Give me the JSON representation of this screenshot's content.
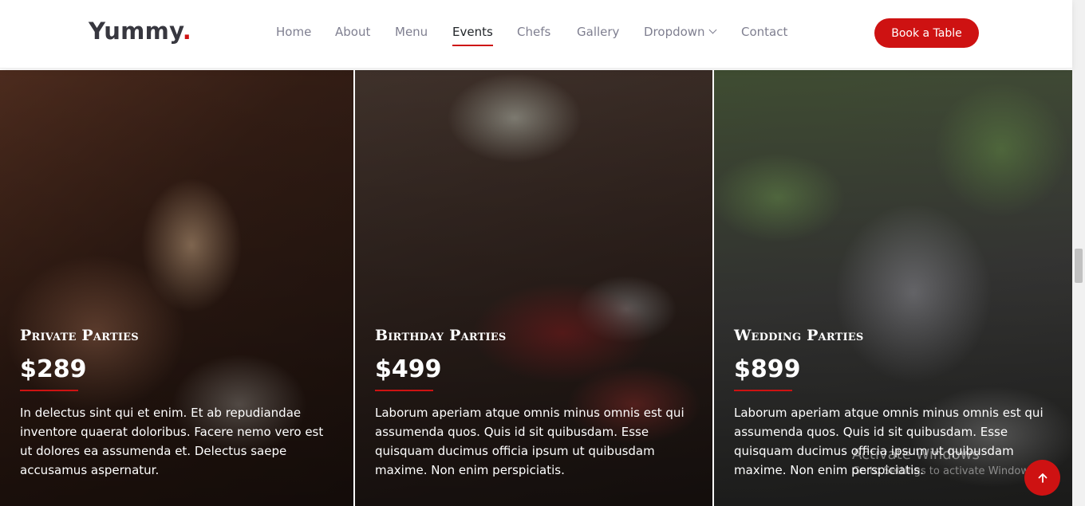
{
  "brand": {
    "name": "Yummy",
    "dot": "."
  },
  "nav": {
    "items": [
      {
        "label": "Home"
      },
      {
        "label": "About"
      },
      {
        "label": "Menu"
      },
      {
        "label": "Events"
      },
      {
        "label": "Chefs"
      },
      {
        "label": "Gallery"
      },
      {
        "label": "Dropdown"
      },
      {
        "label": "Contact"
      }
    ],
    "active": "Events"
  },
  "cta": {
    "label": "Book a Table"
  },
  "events": [
    {
      "title": "Private Parties",
      "price": "$289",
      "description": "In delectus sint qui et enim. Et ab repudiandae inventore quaerat doloribus. Facere nemo vero est ut dolores ea assumenda et. Delectus saepe accusamus aspernatur."
    },
    {
      "title": "Birthday Parties",
      "price": "$499",
      "description": "Laborum aperiam atque omnis minus omnis est qui assumenda quos. Quis id sit quibusdam. Esse quisquam ducimus officia ipsum ut quibusdam maxime. Non enim perspiciatis."
    },
    {
      "title": "Wedding Parties",
      "price": "$899",
      "description": "Laborum aperiam atque omnis minus omnis est qui assumenda quos. Quis id sit quibusdam. Esse quisquam ducimus officia ipsum ut quibusdam maxime. Non enim perspiciatis."
    }
  ],
  "watermark": {
    "line1": "Activate Windows",
    "line2": "Go to Settings to activate Windows."
  },
  "colors": {
    "accent": "#ce1212",
    "text_dark": "#37373f",
    "nav_text": "#7f7f90"
  },
  "icons": {
    "dropdown": "chevron-down-icon",
    "to_top": "arrow-up-icon"
  }
}
